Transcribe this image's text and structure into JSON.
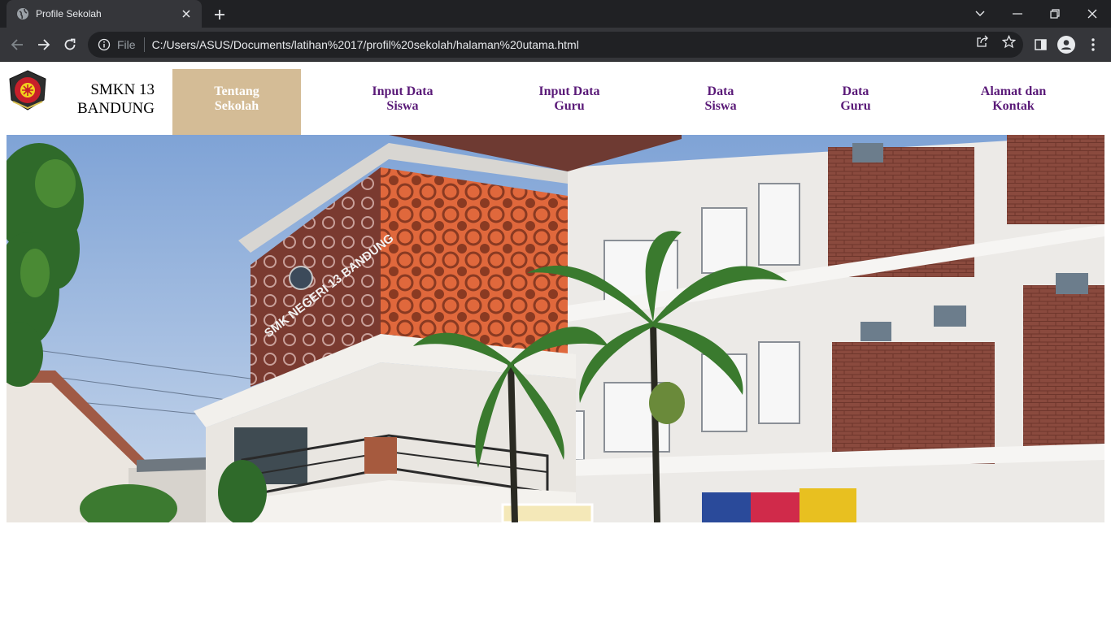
{
  "browser": {
    "tab_title": "Profile Sekolah",
    "scheme_label": "File",
    "url": "C:/Users/ASUS/Documents/latihan%2017/profil%20sekolah/halaman%20utama.html"
  },
  "header": {
    "school_name_line1": "SMKN 13",
    "school_name_line2": "BANDUNG",
    "logo_icon": "school-emblem-icon"
  },
  "nav": {
    "items": [
      {
        "line1": "Tentang",
        "line2": "Sekolah",
        "active": true
      },
      {
        "line1": "Input Data",
        "line2": "Siswa",
        "active": false
      },
      {
        "line1": "Input Data",
        "line2": "Guru",
        "active": false
      },
      {
        "line1": "Data",
        "line2": "Siswa",
        "active": false
      },
      {
        "line1": "Data",
        "line2": "Guru",
        "active": false
      },
      {
        "line1": "Alamat dan",
        "line2": "Kontak",
        "active": false
      }
    ]
  },
  "hero": {
    "image_subject": "school-building-photo",
    "building_sign": "SMK NEGERI 13 BANDUNG"
  },
  "colors": {
    "nav_text": "#5a1a78",
    "nav_active_bg": "#d4bc96",
    "chrome_dark": "#202124",
    "chrome_toolbar": "#35363a"
  }
}
